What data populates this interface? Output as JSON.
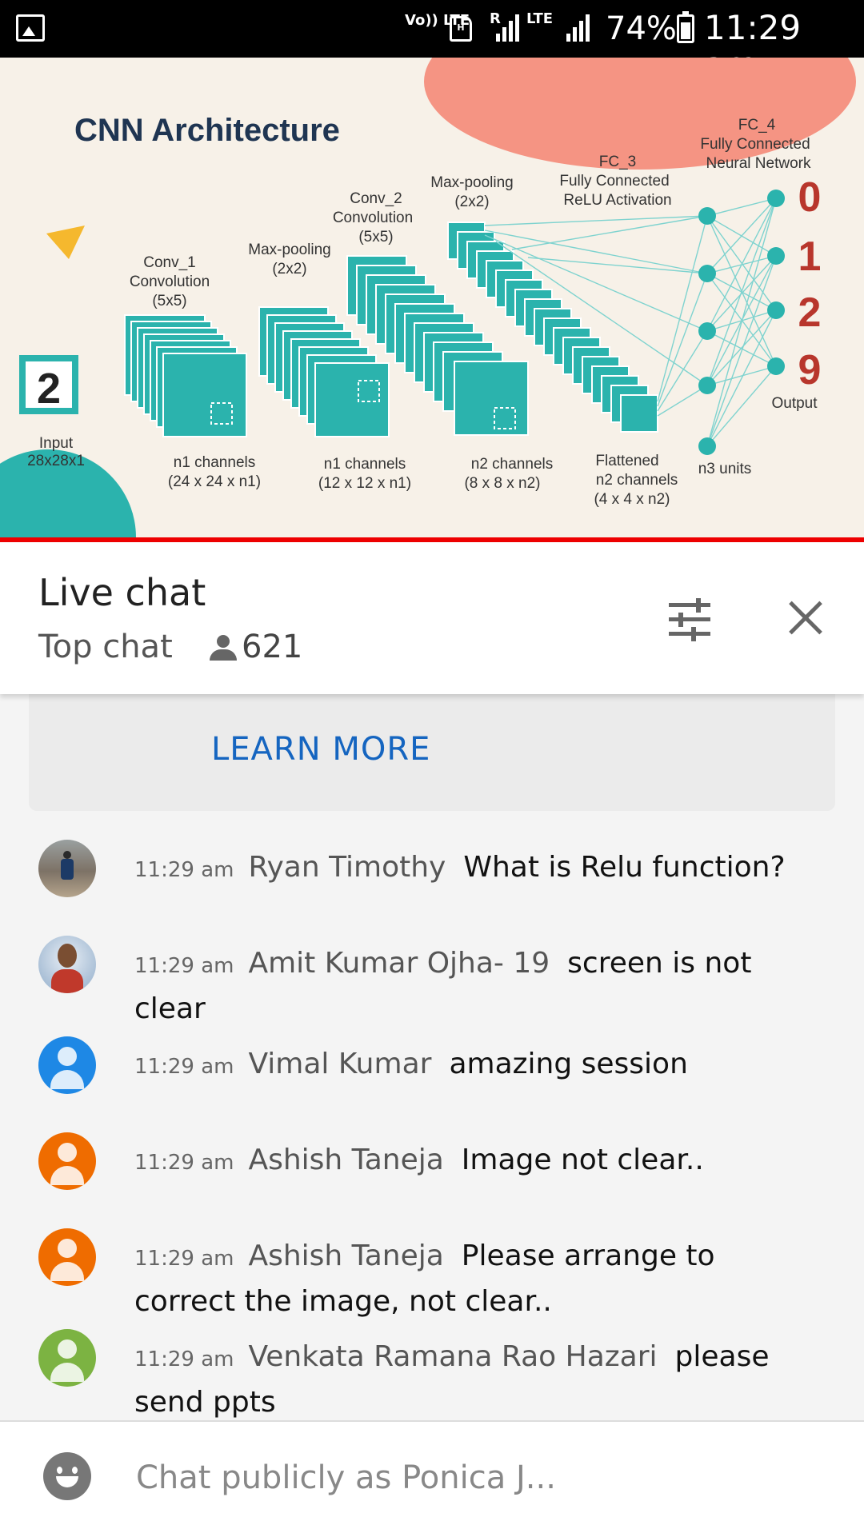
{
  "status_bar": {
    "volte_label": "Vo))\nLTE",
    "network_label": "R",
    "lte_label": "LTE",
    "battery_percent": "74%",
    "time": "11:29 am"
  },
  "slide": {
    "title": "CNN Architecture",
    "input_digit": "2",
    "input_label": "Input",
    "input_size": "28x28x1",
    "conv1_title": "Conv_1",
    "conv1_sub": "Convolution",
    "conv1_kernel": "(5x5)",
    "pool1_title": "Max-pooling",
    "pool1_kernel": "(2x2)",
    "conv2_title": "Conv_2",
    "conv2_sub": "Convolution",
    "conv2_kernel": "(5x5)",
    "pool2_title": "Max-pooling",
    "pool2_kernel": "(2x2)",
    "fc3_title": "FC_3",
    "fc3_sub1": "Fully Connected",
    "fc3_sub2": "ReLU Activation",
    "fc4_title": "FC_4",
    "fc4_sub1": "Fully Connected",
    "fc4_sub2": "Neural Network",
    "outputs": [
      "0",
      "1",
      "2",
      "9"
    ],
    "output_label": "Output",
    "ch1_a": "n1 channels",
    "ch1_b": "(24 x 24 x n1)",
    "ch2_a": "n1 channels",
    "ch2_b": "(12 x 12 x n1)",
    "ch3_a": "n2 channels",
    "ch3_b": "(8 x 8 x n2)",
    "ch4_a": "Flattened",
    "ch4_b": "n2 channels",
    "ch4_c": "(4 x 4 x n2)",
    "n3_label": "n3 units"
  },
  "chat_header": {
    "title": "Live chat",
    "mode": "Top chat",
    "viewers": "621"
  },
  "promo": {
    "learn_more": "LEARN MORE"
  },
  "messages": [
    {
      "time": "11:29 am",
      "author": "Ryan Timothy",
      "text": "What is Relu function?"
    },
    {
      "time": "11:29 am",
      "author": "Amit Kumar Ojha- 19",
      "text": "screen is not clear"
    },
    {
      "time": "11:29 am",
      "author": "Vimal Kumar",
      "text": "amazing session"
    },
    {
      "time": "11:29 am",
      "author": "Ashish Taneja",
      "text": "Image not clear.."
    },
    {
      "time": "11:29 am",
      "author": "Ashish Taneja",
      "text": "Please arrange to correct the image, not clear.."
    },
    {
      "time": "11:29 am",
      "author": "Venkata Ramana Rao Hazari",
      "text": "please send ppts"
    }
  ],
  "colors": {
    "avatar_blue": "#1e88e5",
    "avatar_orange": "#ef6c00",
    "avatar_green": "#7cb342",
    "accent_link": "#1565c0",
    "progress_red": "#ee0000",
    "slide_teal": "#2bb3ad"
  },
  "input": {
    "placeholder": "Chat publicly as Ponica J..."
  }
}
